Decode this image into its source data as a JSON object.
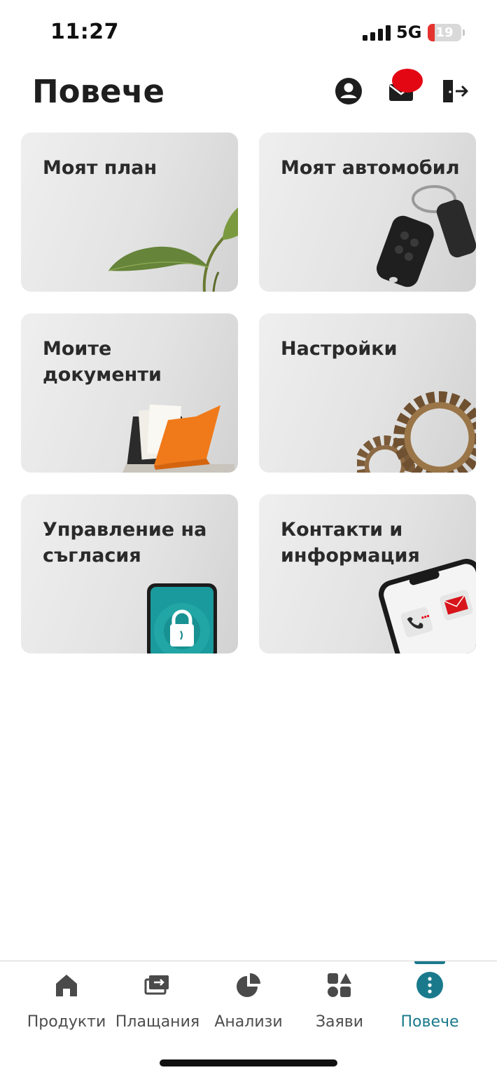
{
  "status_bar": {
    "time": "11:27",
    "network": "5G",
    "battery_level": "19",
    "battery_color": "#e5322f"
  },
  "header": {
    "title": "Повече",
    "icons": [
      "profile-icon",
      "mail-icon",
      "logout-icon"
    ],
    "notification_color": "#e30613"
  },
  "tiles": [
    {
      "title": "Моят план",
      "art": "plant-icon"
    },
    {
      "title": "Моят автомобил",
      "art": "car-key-icon"
    },
    {
      "title": "Моите документи",
      "art": "documents-folder-icon"
    },
    {
      "title": "Настройки",
      "art": "gears-icon"
    },
    {
      "title": "Управление на съгласия",
      "art": "phone-lock-icon"
    },
    {
      "title": "Контакти и информация",
      "art": "phone-contact-icon"
    }
  ],
  "tabbar": {
    "accent_color": "#1a7a8c",
    "tabs": [
      {
        "label": "Продукти",
        "icon": "home-icon",
        "active": false
      },
      {
        "label": "Плащания",
        "icon": "payments-icon",
        "active": false
      },
      {
        "label": "Анализи",
        "icon": "pie-chart-icon",
        "active": false
      },
      {
        "label": "Заяви",
        "icon": "shapes-icon",
        "active": false
      },
      {
        "label": "Повече",
        "icon": "more-icon",
        "active": true
      }
    ]
  }
}
